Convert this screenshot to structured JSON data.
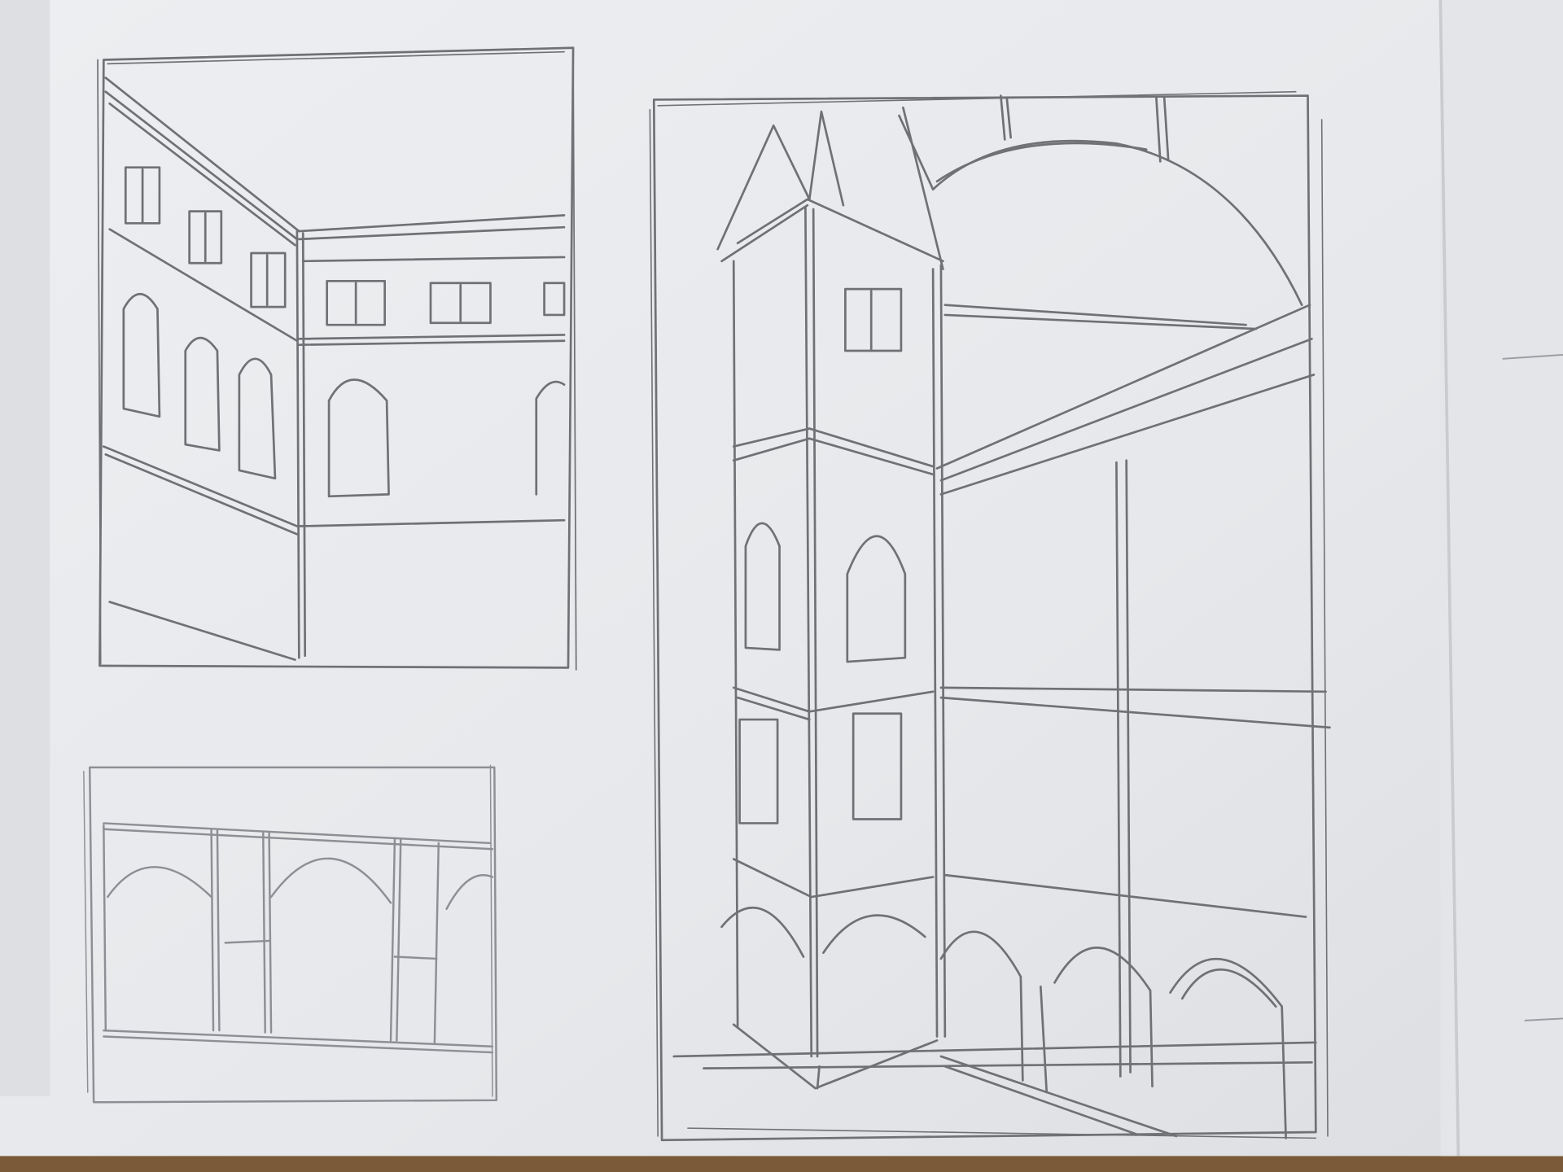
{
  "image": {
    "kind": "photo",
    "subject": "pencil sketches",
    "colors": {
      "table": "#8a6a44",
      "paper": "#e9ebee",
      "paper_shadow": "#d9dbdf",
      "pencil": "#6f6f74",
      "pencil_light": "#9c9ca2"
    }
  }
}
